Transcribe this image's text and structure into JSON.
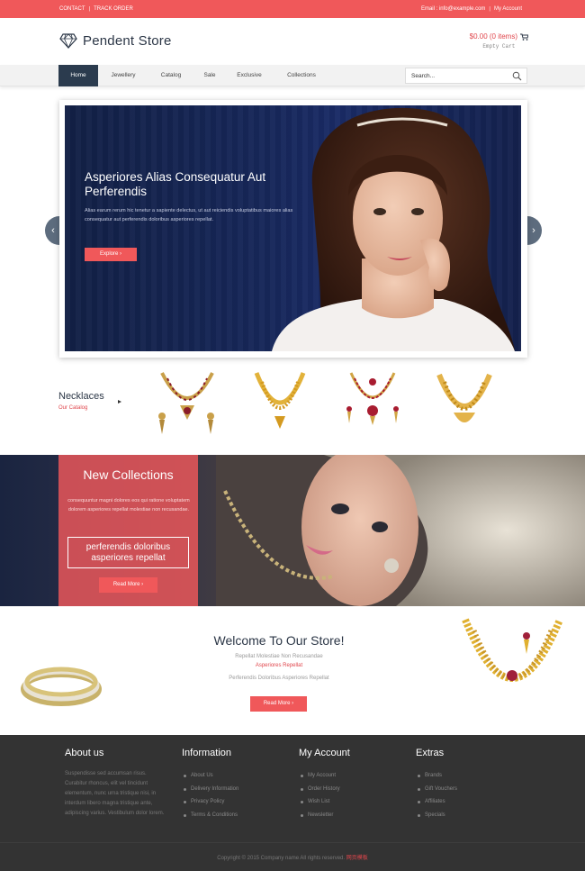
{
  "topbar": {
    "contact": "CONTACT",
    "track_order": "TRACK ORDER",
    "email": "Email : info@example.com",
    "my_account": "My Account"
  },
  "header": {
    "brand": "Pendent Store",
    "cart_total": "$0.00 (0 items)",
    "cart_status": "Empty Cart"
  },
  "nav": {
    "items": [
      "Home",
      "Jewellery",
      "Catalog",
      "Sale",
      "Exclusive",
      "Collections"
    ],
    "search_placeholder": "Search..."
  },
  "slider": {
    "title": "Asperiores Alias Consequatur Aut Perferendis",
    "text": "Alias earum rerum hic tenetur a sapiente delectus, ut aut reiciendis voluptatibus maiores alias consequatur aut perferendis doloribus asperiores repellat.",
    "button": "Explore",
    "prev": "‹",
    "next": "›"
  },
  "necklaces": {
    "title": "Necklaces",
    "subtitle": "Our Catalog"
  },
  "collections": {
    "title": "New Collections",
    "text": "consequuntur magni dolores eos qui ratione voluptatem dolorem asperiores repellat molestiae non recusandae.",
    "box_line1": "perferendis doloribus",
    "box_line2": "asperiores repellat",
    "button": "Read More"
  },
  "welcome": {
    "title": "Welcome To Our Store!",
    "line1": "Repellat Molestiae Non Recusandae",
    "line2": "Asperiores Repellat",
    "line3": "Perferendis Doloribus Asperiores Repellat",
    "button": "Read More"
  },
  "footer": {
    "about": {
      "title": "About us",
      "text": "Suspendisse sed accumsan risus. Curabitur rhoncus, elit vel tincidunt elementum, nunc urna tristique nisi, in interdum libero magna tristique ante, adipiscing varius. Vestibulum dolor lorem."
    },
    "information": {
      "title": "Information",
      "items": [
        "About Us",
        "Delivery Information",
        "Privacy Policy",
        "Terms & Conditions"
      ]
    },
    "account": {
      "title": "My Account",
      "items": [
        "My Account",
        "Order History",
        "Wish List",
        "Newsletter"
      ]
    },
    "extras": {
      "title": "Extras",
      "items": [
        "Brands",
        "Gift Vouchers",
        "Affiliates",
        "Specials"
      ]
    },
    "copyright": "Copyright © 2015 Company name All rights reserved.",
    "copyright_link": "网页模板"
  },
  "colors": {
    "accent": "#f0585a",
    "navy": "#2b3b4e",
    "footer": "#333333"
  }
}
